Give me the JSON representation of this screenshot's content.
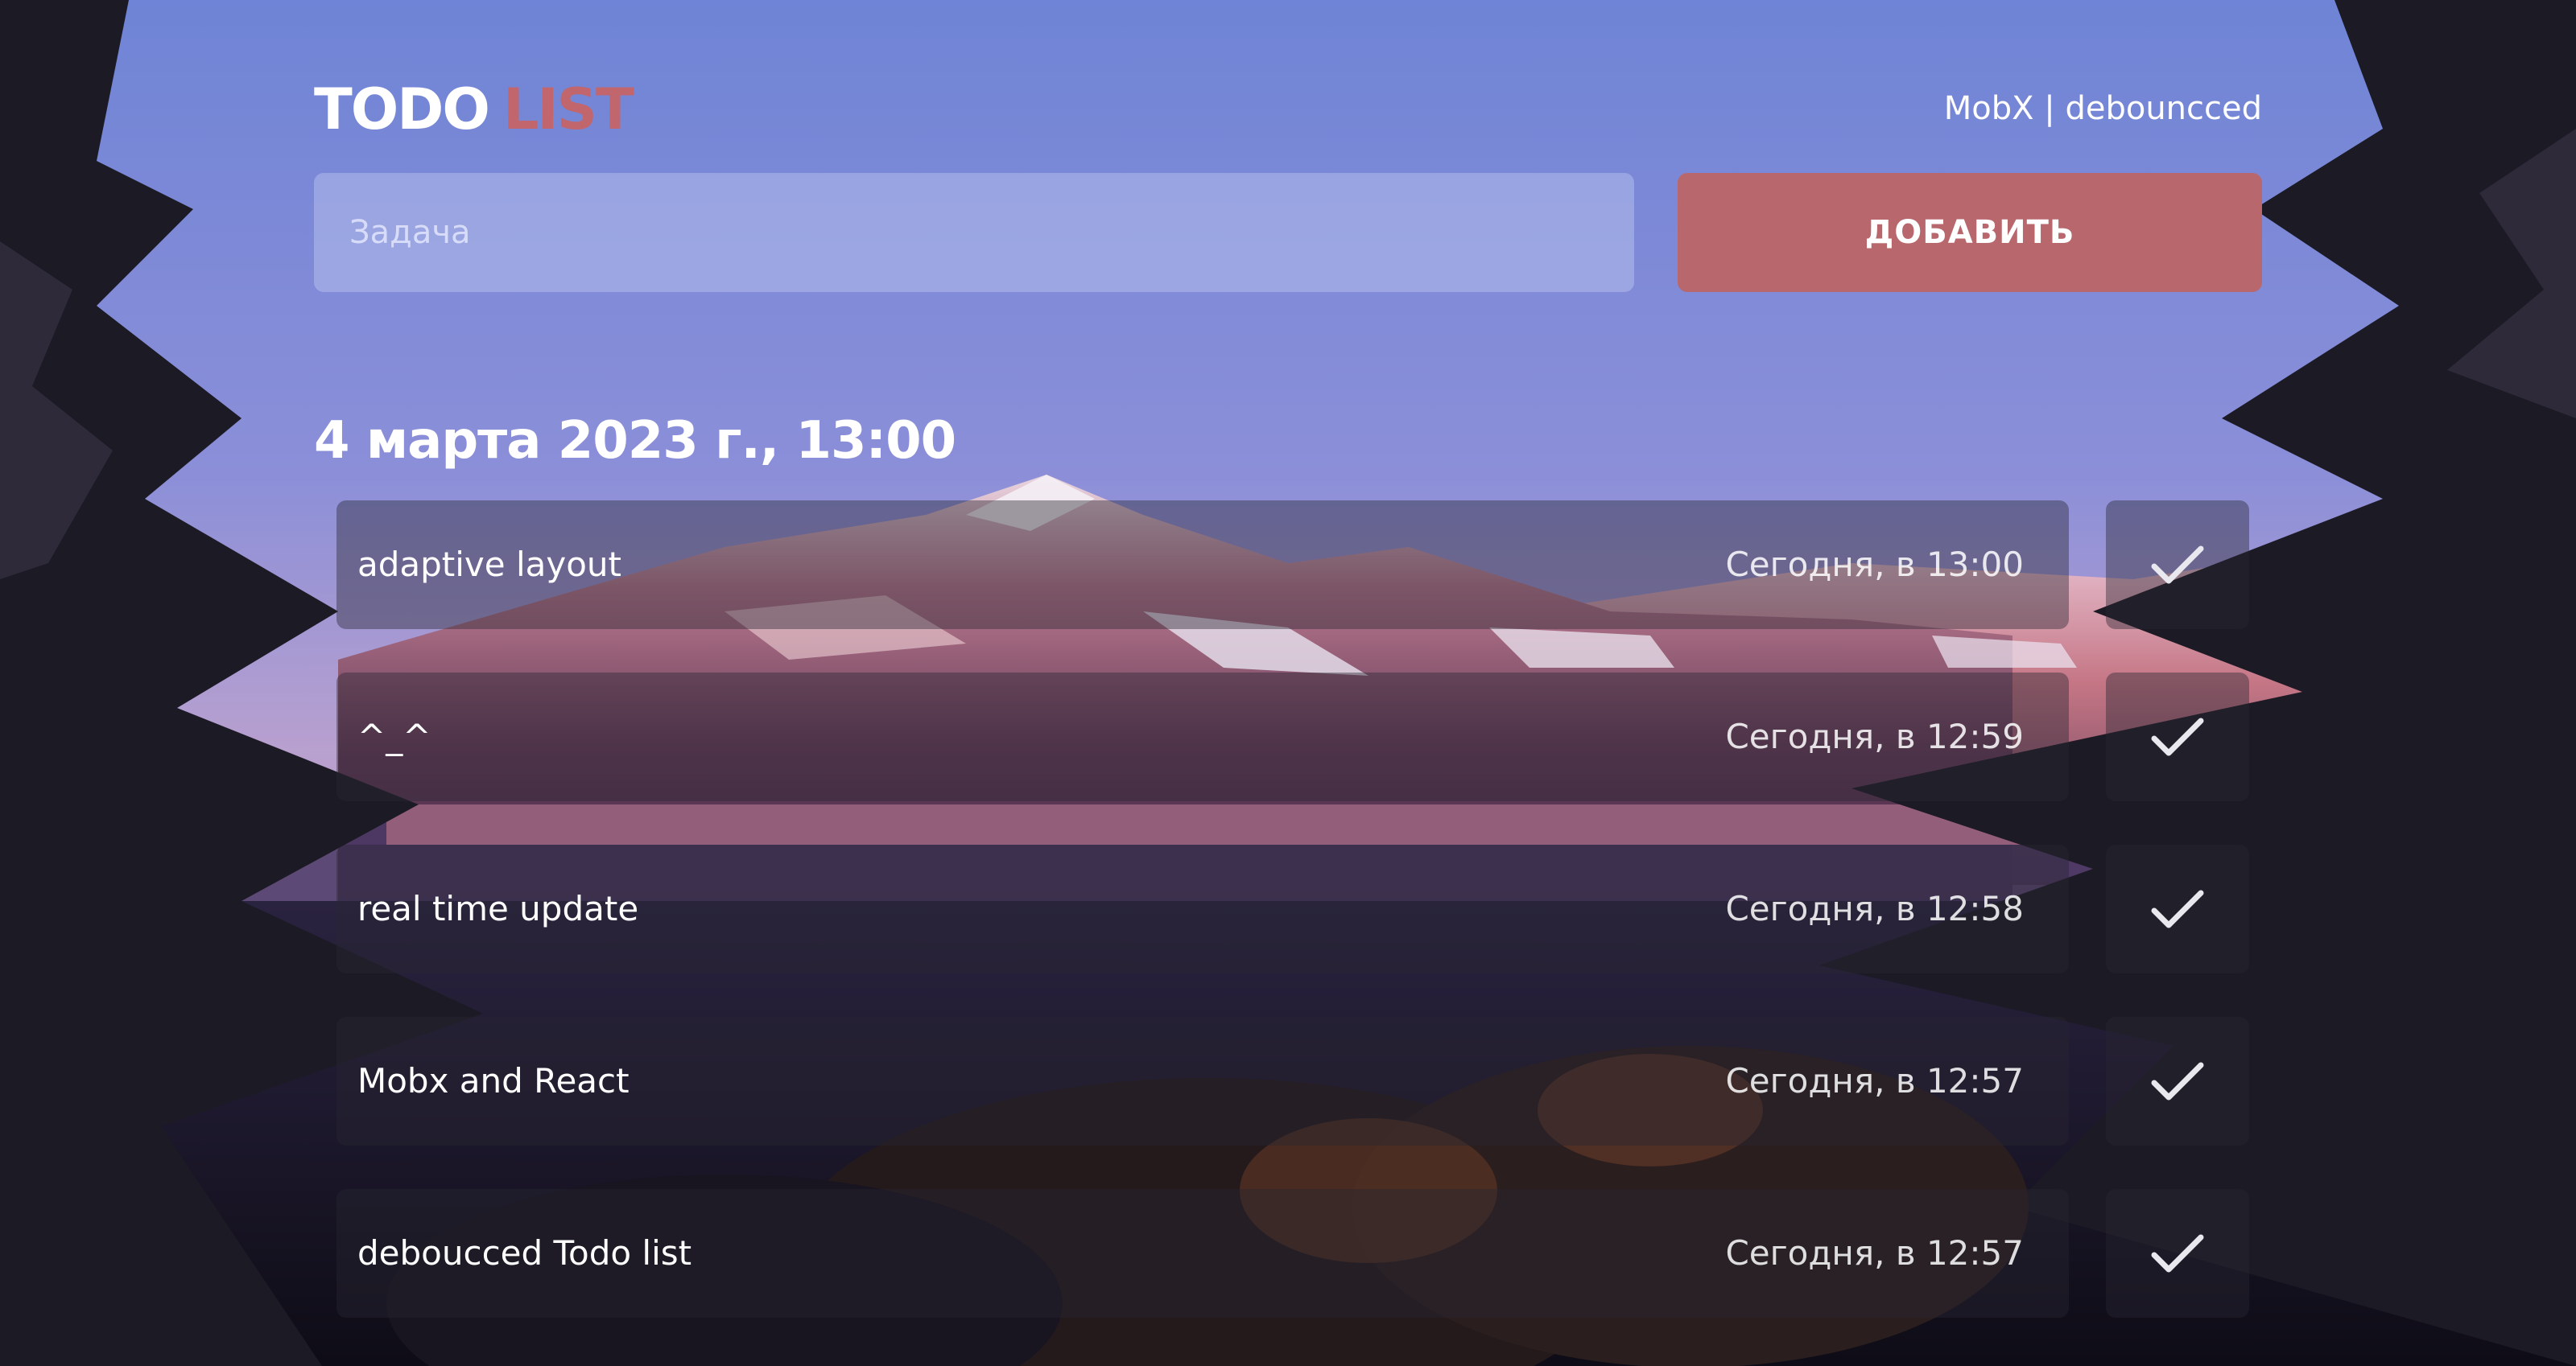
{
  "app": {
    "logo_word1": "TODO",
    "logo_word2": "LIST",
    "subtitle": "MobX | debouncced"
  },
  "form": {
    "input_placeholder": "Задача",
    "input_value": "",
    "add_button_label": "ДОБАВИТЬ"
  },
  "date_heading": "4 марта 2023 г., 13:00",
  "todos": [
    {
      "title": "adaptive layout",
      "time": "Сегодня, в 13:00",
      "icon": "check-icon"
    },
    {
      "title": "^_^",
      "time": "Сегодня, в 12:59",
      "icon": "check-icon"
    },
    {
      "title": "real time update",
      "time": "Сегодня, в 12:58",
      "icon": "check-icon"
    },
    {
      "title": "Mobx and React",
      "time": "Сегодня, в 12:57",
      "icon": "check-icon"
    },
    {
      "title": "deboucced Todo list",
      "time": "Сегодня, в 12:57",
      "icon": "check-icon"
    }
  ],
  "colors": {
    "accent": "#b8686d",
    "logo_accent": "#c0666c"
  }
}
